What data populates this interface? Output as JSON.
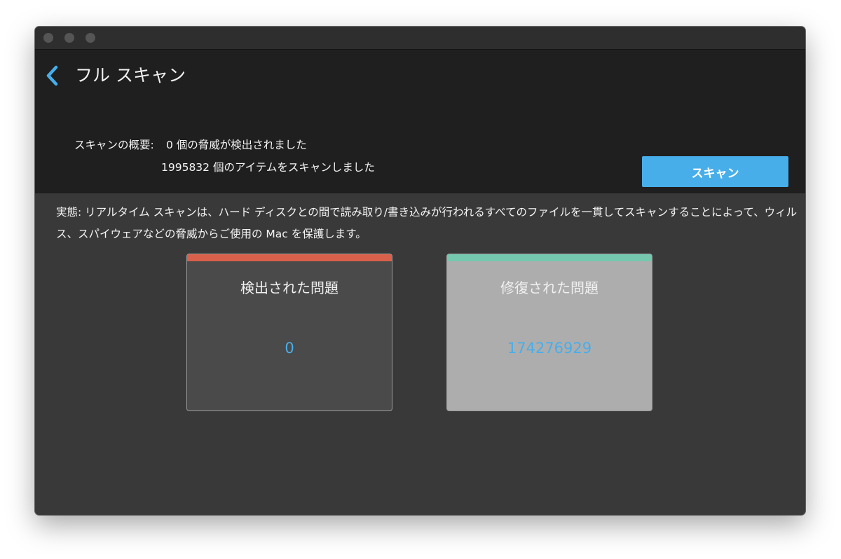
{
  "header": {
    "title": "フル スキャン"
  },
  "summary": {
    "label": "スキャンの概要:",
    "threats_line": "0 個の脅威が検出されました",
    "items_line": "1995832 個のアイテムをスキャンしました"
  },
  "actions": {
    "scan_label": "スキャン"
  },
  "description": "実態: リアルタイム スキャンは、ハード ディスクとの間で読み取り/書き込みが行われるすべてのファイルを一貫してスキャンすることによって、ウィルス、スパイウェアなどの脅威からご使用の Mac を保護します。",
  "cards": [
    {
      "title": "検出された問題",
      "value": "0",
      "accent": "#d9604a",
      "background": "#4a4a4a"
    },
    {
      "title": "修復された問題",
      "value": "174276929",
      "accent": "#75c8ae",
      "background": "#adadad"
    }
  ],
  "colors": {
    "accent_blue": "#48aeea",
    "header_background": "#1f1f1f",
    "content_background": "#393939"
  },
  "icons": {
    "back": "chevron-left-icon"
  }
}
